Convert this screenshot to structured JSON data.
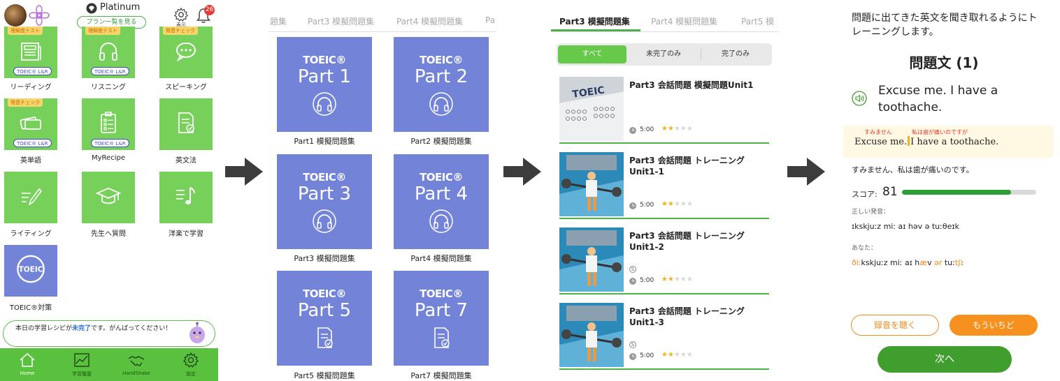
{
  "colors": {
    "green": "#76d05a",
    "blue_tile": "#7384d8",
    "tab_green": "#5ac13f",
    "accent_green": "#4bb14b",
    "orange": "#f6911f"
  },
  "screen1": {
    "plan_name": "Platinum",
    "plan_button": "プラン一覧を見る",
    "settings_label": "表示",
    "notification_count": "26",
    "tiles": [
      {
        "label": "リーディング",
        "ribbon": "理解度テスト",
        "tag": "TOEIC® L&R",
        "icon": "newspaper-icon"
      },
      {
        "label": "リスニング",
        "ribbon": "理解度テスト",
        "tag": "TOEIC® L&R",
        "icon": "headphones-icon"
      },
      {
        "label": "スピーキング",
        "ribbon": "発音チェック",
        "tag": "",
        "icon": "chat-bubble-icon"
      },
      {
        "label": "英単語",
        "ribbon": "発音チェック",
        "tag": "TOEIC® L&R",
        "icon": "flashcards-icon"
      },
      {
        "label": "MyRecipe",
        "ribbon": "",
        "tag": "TOEIC® L&R",
        "icon": "clipboard-icon"
      },
      {
        "label": "英文法",
        "ribbon": "",
        "tag": "",
        "icon": "document-check-icon"
      },
      {
        "label": "ライティング",
        "ribbon": "",
        "tag": "",
        "icon": "pencil-lines-icon"
      },
      {
        "label": "先生へ質問",
        "ribbon": "",
        "tag": "",
        "icon": "graduation-cap-icon"
      },
      {
        "label": "洋楽で学習",
        "ribbon": "",
        "tag": "",
        "icon": "music-note-icon"
      },
      {
        "label": "TOEIC®対策",
        "ribbon": "",
        "tag": "",
        "icon": "toeic-badge-icon",
        "badge_text": "TOEIC"
      }
    ],
    "recipe_prefix": "本日の学習レシピが",
    "recipe_highlight": "未完了",
    "recipe_suffix": "です。がんばってください！",
    "tabbar": [
      {
        "label": "Home",
        "icon": "home-icon"
      },
      {
        "label": "学習履歴",
        "icon": "chart-icon"
      },
      {
        "label": "HandShake",
        "icon": "handshake-icon"
      },
      {
        "label": "設定",
        "icon": "gear-icon"
      }
    ]
  },
  "screen2": {
    "tabs": [
      "題集",
      "Part3 模擬問題集",
      "Part4 模擬問題集",
      "Pa"
    ],
    "brand": "TOEIC®",
    "cards": [
      {
        "part": "Part 1",
        "label": "Part1 模擬問題集",
        "icon": "headphones-icon"
      },
      {
        "part": "Part 2",
        "label": "Part2 模擬問題集",
        "icon": "headphones-icon"
      },
      {
        "part": "Part 3",
        "label": "Part3 模擬問題集",
        "icon": "headphones-icon"
      },
      {
        "part": "Part 4",
        "label": "Part4 模擬問題集",
        "icon": "headphones-icon"
      },
      {
        "part": "Part 5",
        "label": "Part5 模擬問題集",
        "icon": "document-check-icon"
      },
      {
        "part": "Part 7",
        "label": "Part7 模擬問題集",
        "icon": "document-check-icon"
      }
    ]
  },
  "screen3": {
    "tabs": [
      "Part3 模擬問題集",
      "Part4 模擬問題集",
      "Part5 模"
    ],
    "filters": [
      "すべて",
      "未完了のみ",
      "完了のみ"
    ],
    "items": [
      {
        "title": "Part3 会話問題 模擬問題Unit1",
        "time": "5:00",
        "stars": 2,
        "max_stars": 5,
        "coin": "",
        "thumb": "answer-sheet"
      },
      {
        "title": "Part3 会話問題 トレーニングUnit1-1",
        "time": "5:00",
        "stars": 2,
        "max_stars": 5,
        "coin": "",
        "thumb": "gym"
      },
      {
        "title": "Part3 会話問題 トレーニングUnit1-2",
        "time": "5:00",
        "stars": 2,
        "max_stars": 5,
        "coin": "S",
        "thumb": "gym"
      },
      {
        "title": "Part3 会話問題 トレーニングUnit1-3",
        "time": "5:00",
        "stars": 2,
        "max_stars": 5,
        "coin": "S",
        "thumb": "gym"
      }
    ]
  },
  "screen4": {
    "instruction": "問題に出てきた英文を聞き取れるようにトレーニングします。",
    "heading": "問題文 (1)",
    "sentence": "Excuse me. I have a toothache.",
    "annotation1": "すみません",
    "annotation2": "私は歯が痛いのですが",
    "sentence_part1": "Excuse me.",
    "sentence_part2": "I have a toothache.",
    "translation": "すみません、私は歯が痛いのです。",
    "score_label": "スコア:",
    "score": 81,
    "score_max": 100,
    "correct_label": "正しい発音：",
    "correct_ipa": "ɪkskjuːz miː aɪ həv ə tuːθeɪk",
    "yours_label": "あなた：",
    "yours_ipa": [
      {
        "t": "ðiː",
        "bad": true
      },
      {
        "t": "kskjuːz miː aɪ h",
        "bad": false
      },
      {
        "t": "æ",
        "bad": true
      },
      {
        "t": "v ",
        "bad": false
      },
      {
        "t": "ər",
        "bad": true
      },
      {
        "t": " tuː",
        "bad": false
      },
      {
        "t": "tʃɪ",
        "bad": true
      }
    ],
    "btn_listen": "録音を聴く",
    "btn_retry": "もういちど",
    "btn_next": "次へ"
  }
}
